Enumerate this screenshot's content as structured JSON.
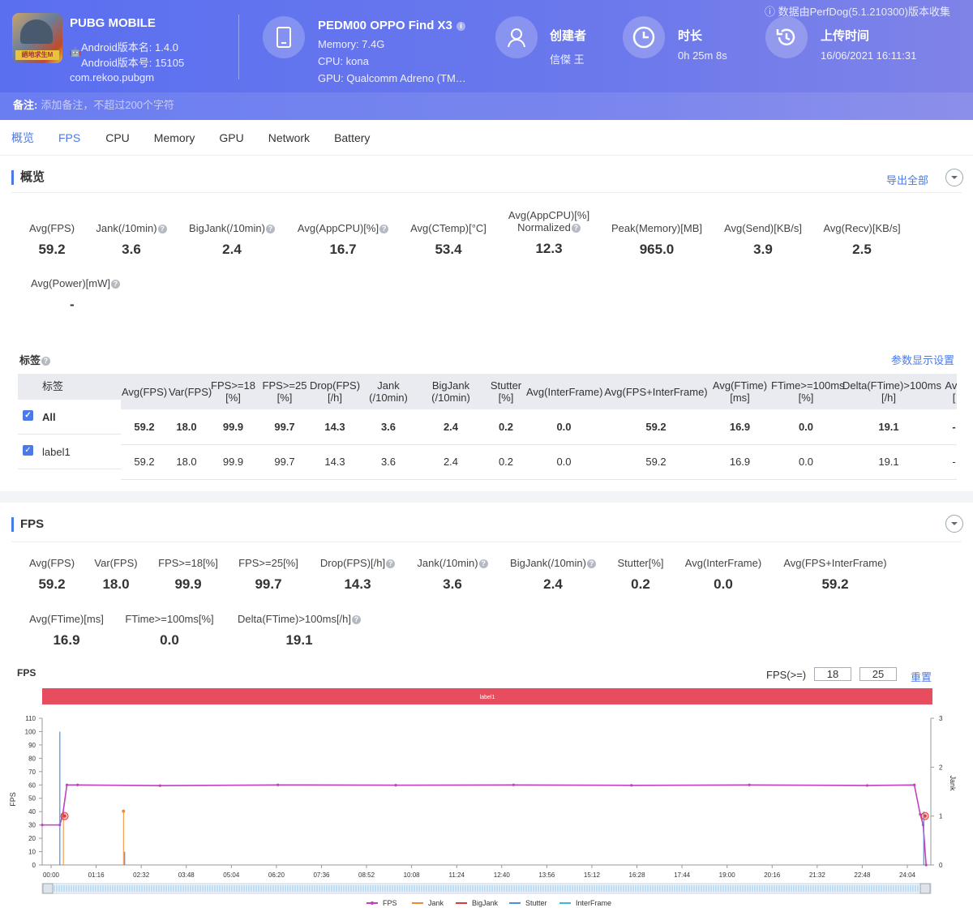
{
  "notice": "数据由PerfDog(5.1.210300)版本收集",
  "app": {
    "name": "PUBG MOBILE",
    "icon_text": "絕地求生M",
    "version_name": "Android版本名: 1.4.0",
    "version_code": "Android版本号: 15105",
    "package": "com.rekoo.pubgm"
  },
  "device": {
    "model": "PEDM00 OPPO Find X3",
    "memory": "Memory: 7.4G",
    "cpu": "CPU: kona",
    "gpu": "GPU: Qualcomm Adreno (TM…"
  },
  "creator": {
    "title": "创建者",
    "value": "信傑 王"
  },
  "duration": {
    "title": "时长",
    "value": "0h 25m 8s"
  },
  "upload": {
    "title": "上传时间",
    "value": "16/06/2021 16:11:31"
  },
  "note": {
    "label": "备注:",
    "placeholder": "添加备注，不超过200个字符"
  },
  "tabs": [
    "概览",
    "FPS",
    "CPU",
    "Memory",
    "GPU",
    "Network",
    "Battery"
  ],
  "overview": {
    "title": "概览",
    "export": "导出全部",
    "metrics": [
      {
        "label": "Avg(FPS)",
        "value": "59.2"
      },
      {
        "label": "Jank(/10min)",
        "value": "3.6"
      },
      {
        "label": "BigJank(/10min)",
        "value": "2.4"
      },
      {
        "label": "Avg(AppCPU)[%]",
        "value": "16.7"
      },
      {
        "label": "Avg(CTemp)[°C]",
        "value": "53.4"
      },
      {
        "label": "Avg(AppCPU)[%]",
        "label2": "Normalized",
        "value": "12.3"
      },
      {
        "label": "Peak(Memory)[MB]",
        "value": "965.0"
      },
      {
        "label": "Avg(Send)[KB/s]",
        "value": "3.9"
      },
      {
        "label": "Avg(Recv)[KB/s]",
        "value": "2.5"
      },
      {
        "label": "Avg(Power)[mW]",
        "value": "-"
      }
    ]
  },
  "labels": {
    "title": "标签",
    "settings": "参数显示设置",
    "col_label": "标签",
    "headers": [
      [
        "Avg(FPS)"
      ],
      [
        "Var(FPS)"
      ],
      [
        "FPS>=18",
        "[%]"
      ],
      [
        "FPS>=25",
        "[%]"
      ],
      [
        "Drop(FPS)",
        "[/h]"
      ],
      [
        "Jank",
        "(/10min)"
      ],
      [
        "BigJank",
        "(/10min)"
      ],
      [
        "Stutter",
        "[%]"
      ],
      [
        "Avg(InterFrame)"
      ],
      [
        "Avg(FPS+InterFrame)"
      ],
      [
        "Avg(FTime)",
        "[ms]"
      ],
      [
        "FTime>=100ms",
        "[%]"
      ],
      [
        "Delta(FTime)>100ms",
        "[/h]"
      ],
      [
        "Avg",
        "["
      ]
    ],
    "rows": [
      {
        "name": "All",
        "values": [
          "59.2",
          "18.0",
          "99.9",
          "99.7",
          "14.3",
          "3.6",
          "2.4",
          "0.2",
          "0.0",
          "59.2",
          "16.9",
          "0.0",
          "19.1",
          "-"
        ]
      },
      {
        "name": "label1",
        "values": [
          "59.2",
          "18.0",
          "99.9",
          "99.7",
          "14.3",
          "3.6",
          "2.4",
          "0.2",
          "0.0",
          "59.2",
          "16.9",
          "0.0",
          "19.1",
          "-"
        ]
      }
    ]
  },
  "fps_section": {
    "title": "FPS",
    "metrics": [
      {
        "label": "Avg(FPS)",
        "value": "59.2"
      },
      {
        "label": "Var(FPS)",
        "value": "18.0"
      },
      {
        "label": "FPS>=18[%]",
        "value": "99.9"
      },
      {
        "label": "FPS>=25[%]",
        "value": "99.7"
      },
      {
        "label": "Drop(FPS)[/h]",
        "value": "14.3"
      },
      {
        "label": "Jank(/10min)",
        "value": "3.6"
      },
      {
        "label": "BigJank(/10min)",
        "value": "2.4"
      },
      {
        "label": "Stutter[%]",
        "value": "0.2"
      },
      {
        "label": "Avg(InterFrame)",
        "value": "0.0"
      },
      {
        "label": "Avg(FPS+InterFrame)",
        "value": "59.2"
      },
      {
        "label": "Avg(FTime)[ms]",
        "value": "16.9"
      },
      {
        "label": "FTime>=100ms[%]",
        "value": "0.0"
      },
      {
        "label": "Delta(FTime)>100ms[/h]",
        "value": "19.1"
      }
    ],
    "chart_title": "FPS",
    "threshold_label": "FPS(>=)",
    "threshold_1": "18",
    "threshold_2": "25",
    "reset": "重置"
  },
  "chart_data": {
    "type": "line",
    "band_label": "label1",
    "ylabel": "FPS",
    "y2label": "Jank",
    "ylim": [
      0,
      110
    ],
    "y2lim": [
      0,
      3
    ],
    "y_ticks": [
      "0",
      "10",
      "20",
      "30",
      "40",
      "50",
      "60",
      "70",
      "80",
      "90",
      "100",
      "110"
    ],
    "y2_ticks": [
      "0",
      "1",
      "2",
      "3"
    ],
    "x_ticks": [
      "00:00",
      "01:16",
      "02:32",
      "03:48",
      "05:04",
      "06:20",
      "07:36",
      "08:52",
      "10:08",
      "11:24",
      "12:40",
      "13:56",
      "15:12",
      "16:28",
      "17:44",
      "19:00",
      "20:16",
      "21:32",
      "22:48",
      "24:04"
    ],
    "x_range_sec": [
      0,
      1508
    ],
    "series": [
      {
        "name": "FPS",
        "color": "#c13fc1",
        "points": [
          [
            0,
            30
          ],
          [
            30,
            30
          ],
          [
            35,
            38
          ],
          [
            42,
            60
          ],
          [
            60,
            60
          ],
          [
            200,
            59.5
          ],
          [
            400,
            60
          ],
          [
            600,
            59.8
          ],
          [
            800,
            60
          ],
          [
            1000,
            59.7
          ],
          [
            1200,
            60
          ],
          [
            1400,
            59.6
          ],
          [
            1480,
            60
          ],
          [
            1490,
            38
          ],
          [
            1495,
            30
          ],
          [
            1500,
            0
          ]
        ]
      },
      {
        "name": "Jank",
        "color": "#f08a30",
        "points": [
          [
            36,
            1
          ],
          [
            138,
            1.1
          ]
        ]
      },
      {
        "name": "BigJank",
        "color": "#e03b3b",
        "points": [
          [
            38,
            1
          ],
          [
            1498,
            1
          ]
        ]
      },
      {
        "name": "Stutter",
        "color": "#4a8ce8",
        "points": [
          [
            30,
            100
          ],
          [
            140,
            10
          ],
          [
            1496,
            40
          ]
        ]
      },
      {
        "name": "InterFrame",
        "color": "#3ab9e0",
        "points": []
      }
    ],
    "legend": [
      "FPS",
      "Jank",
      "BigJank",
      "Stutter",
      "InterFrame"
    ],
    "legend_colors": [
      "#c13fc1",
      "#f08a30",
      "#e03b3b",
      "#4a8ce8",
      "#3ab9e0"
    ],
    "legend_position": "bottom",
    "band_color": "#e74c5f"
  }
}
